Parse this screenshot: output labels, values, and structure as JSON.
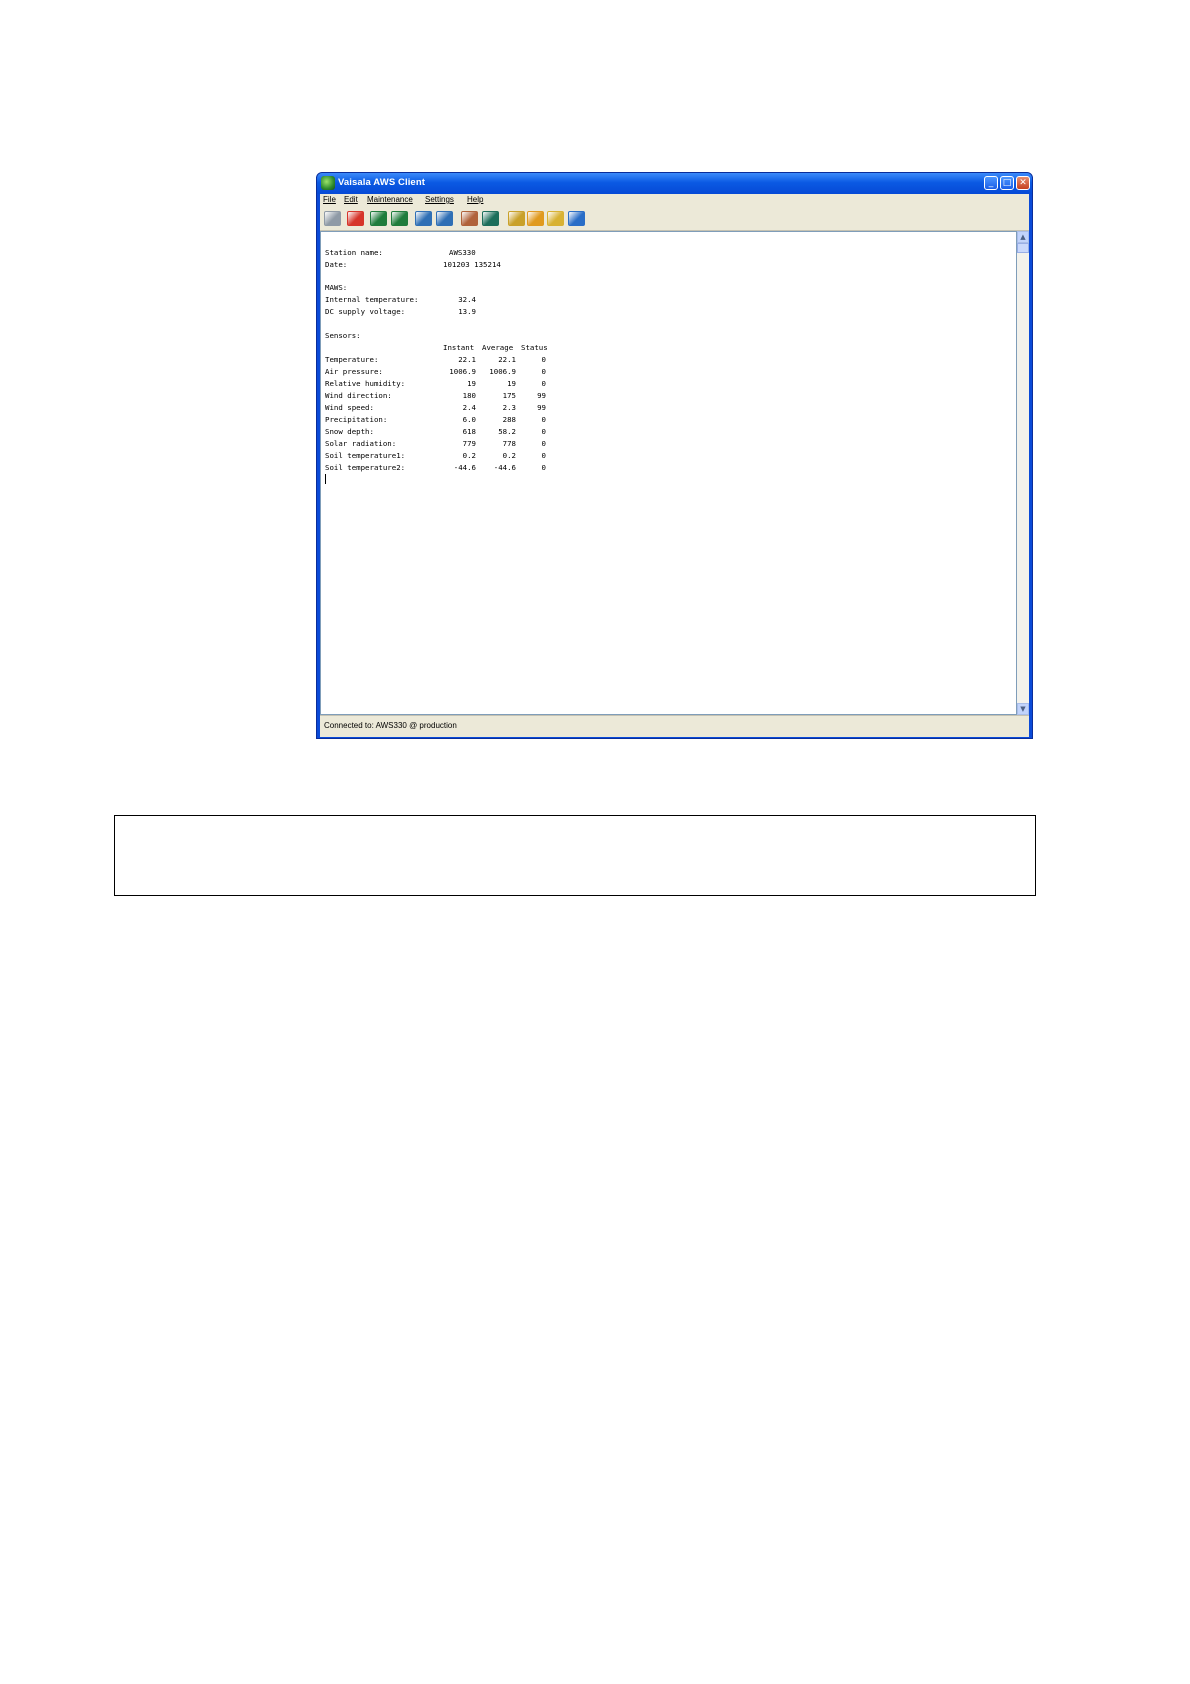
{
  "window": {
    "title": "Vaisala AWS Client",
    "min_glyph": "_",
    "max_glyph": "□",
    "close_glyph": "✕"
  },
  "menu": [
    "File",
    "Edit",
    "Maintenance",
    "Settings",
    "Help"
  ],
  "toolbar_icons": [
    {
      "name": "connect-icon",
      "color": "#8f9aa6"
    },
    {
      "name": "disconnect-icon",
      "color": "#d6352b"
    },
    {
      "name": "open-log-icon",
      "color": "#1f7c3c"
    },
    {
      "name": "close-log-icon",
      "color": "#1f7c3c"
    },
    {
      "name": "upload-icon",
      "color": "#2f6fb5"
    },
    {
      "name": "download-icon",
      "color": "#2f6fb5"
    },
    {
      "name": "copy-icon",
      "color": "#b0623a"
    },
    {
      "name": "terminal-icon",
      "color": "#1d6e5a"
    },
    {
      "name": "database-icon",
      "color": "#c9a12a"
    },
    {
      "name": "settings-icon",
      "color": "#e09a1f"
    },
    {
      "name": "search-icon",
      "color": "#d8b233"
    },
    {
      "name": "info-icon",
      "color": "#2a6ec7"
    }
  ],
  "report": {
    "station_label": "Station name:",
    "station_value": "AWS330",
    "date_label": "Date:",
    "date_value": "101203 135214",
    "maws_header": "MAWS:",
    "internal_temp_label": "Internal temperature:",
    "internal_temp_value": "32.4",
    "dc_voltage_label": "DC supply voltage:",
    "dc_voltage_value": "13.9",
    "sensors_header": "Sensors:",
    "col_instant": "Instant",
    "col_average": "Average",
    "col_status": "Status",
    "sensor_rows": [
      {
        "label": "Temperature:",
        "instant": "22.1",
        "average": "22.1",
        "status": "0"
      },
      {
        "label": "Air pressure:",
        "instant": "1006.9",
        "average": "1006.9",
        "status": "0"
      },
      {
        "label": "Relative humidity:",
        "instant": "19",
        "average": "19",
        "status": "0"
      },
      {
        "label": "Wind direction:",
        "instant": "180",
        "average": "175",
        "status": "99"
      },
      {
        "label": "Wind speed:",
        "instant": "2.4",
        "average": "2.3",
        "status": "99"
      },
      {
        "label": "Precipitation:",
        "instant": "6.0",
        "average": "288",
        "status": "0"
      },
      {
        "label": "Snow depth:",
        "instant": "618",
        "average": "58.2",
        "status": "0"
      },
      {
        "label": "Solar radiation:",
        "instant": "779",
        "average": "778",
        "status": "0"
      },
      {
        "label": "Soil temperature1:",
        "instant": "0.2",
        "average": "0.2",
        "status": "0"
      },
      {
        "label": "Soil temperature2:",
        "instant": "-44.6",
        "average": "-44.6",
        "status": "0"
      }
    ]
  },
  "status_bar": "Connected to: AWS330 @ production"
}
